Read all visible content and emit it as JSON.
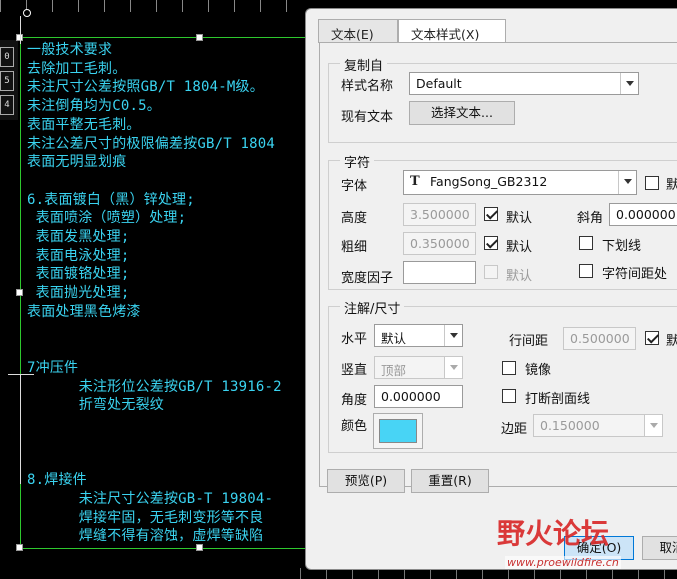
{
  "drawing": {
    "table_cells": [
      "0",
      "5",
      "4"
    ],
    "lines": [
      "一般技术要求",
      "去除加工毛刺。",
      "未注尺寸公差按照GB/T 1804-M级。",
      "未注倒角均为C0.5。",
      "表面平整无毛刺。",
      "未注公差尺寸的极限偏差按GB/T 1804",
      "表面无明显划痕",
      "",
      "6.表面镀白（黑）锌处理;",
      " 表面喷涂（喷塑）处理;",
      " 表面发黑处理;",
      " 表面电泳处理;",
      " 表面镀铬处理;",
      " 表面抛光处理;",
      "表面处理黑色烤漆",
      "",
      "",
      "7冲压件",
      "      未注形位公差按GB/T 13916-2",
      "      折弯处无裂纹",
      "",
      "",
      "",
      "8.焊接件",
      "      未注尺寸公差按GB-T 19804-",
      "      焊接牢固，无毛刺变形等不良",
      "      焊缝不得有溶蚀，虚焊等缺陷"
    ]
  },
  "dialog": {
    "tabs": [
      {
        "label": "文本(E)",
        "active": false
      },
      {
        "label": "文本样式(X)",
        "active": true
      }
    ],
    "copy_from": {
      "title": "复制自",
      "style_name_label": "样式名称",
      "style_name_value": "Default",
      "existing_text_label": "现有文本",
      "select_text_button": "选择文本..."
    },
    "character": {
      "title": "字符",
      "font_label": "字体",
      "font_value": "FangSong_GB2312",
      "font_default_check_label": "默",
      "height_label": "高度",
      "height_value": "3.500000",
      "height_default_label": "默认",
      "slant_label": "斜角",
      "slant_value": "0.000000",
      "thickness_label": "粗细",
      "thickness_value": "0.350000",
      "thickness_default_label": "默认",
      "underline_label": "下划线",
      "width_factor_label": "宽度因子",
      "width_factor_value": "",
      "width_default_label": "默认",
      "char_spacing_label": "字符间距处"
    },
    "note_dimension": {
      "title": "注解/尺寸",
      "horizontal_label": "水平",
      "horizontal_value": "默认",
      "line_spacing_label": "行间距",
      "line_spacing_value": "0.500000",
      "line_spacing_default_label": "默",
      "vertical_label": "竖直",
      "vertical_value": "顶部",
      "mirror_label": "镜像",
      "angle_label": "角度",
      "angle_value": "0.000000",
      "break_hatch_label": "打断剖面线",
      "color_label": "颜色",
      "color_value": "#48d4f5",
      "margin_label": "边距",
      "margin_value": "0.150000"
    },
    "preview_button": "预览(P)",
    "reset_button": "重置(R)",
    "ok_button": "确定(O)",
    "cancel_button": "取消"
  },
  "watermark": {
    "brand": "野火论坛",
    "url": "www.proewildfire.cn"
  }
}
